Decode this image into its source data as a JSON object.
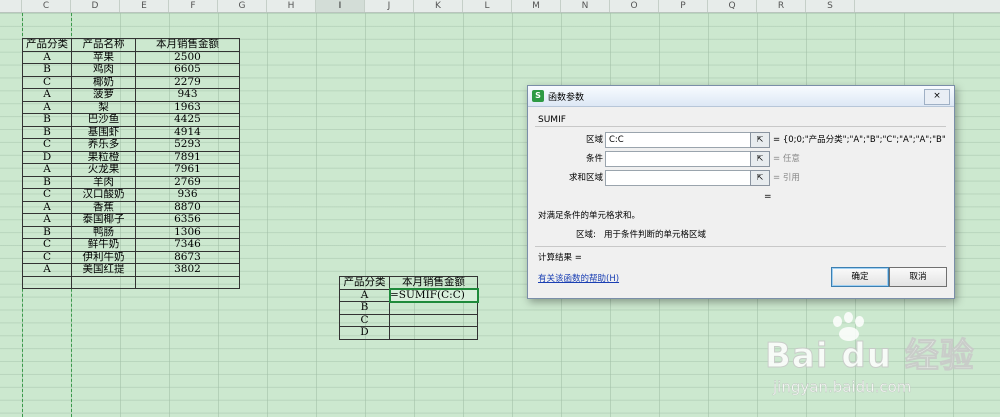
{
  "columns": [
    "C",
    "D",
    "E",
    "F",
    "G",
    "H",
    "I",
    "J",
    "K",
    "L",
    "M",
    "N",
    "O",
    "P",
    "Q",
    "R",
    "S"
  ],
  "selected_column": "I",
  "table1": {
    "headers": [
      "产品分类",
      "产品名称",
      "本月销售金额"
    ],
    "rows": [
      [
        "A",
        "苹果",
        "2500"
      ],
      [
        "B",
        "鸡肉",
        "6605"
      ],
      [
        "C",
        "椰奶",
        "2279"
      ],
      [
        "A",
        "菠萝",
        "943"
      ],
      [
        "A",
        "梨",
        "1963"
      ],
      [
        "B",
        "巴沙鱼",
        "4425"
      ],
      [
        "B",
        "基围虾",
        "4914"
      ],
      [
        "C",
        "养乐多",
        "5293"
      ],
      [
        "D",
        "果粒橙",
        "7891"
      ],
      [
        "A",
        "火龙果",
        "7961"
      ],
      [
        "B",
        "羊肉",
        "2769"
      ],
      [
        "C",
        "汉口酸奶",
        "936"
      ],
      [
        "A",
        "香蕉",
        "8870"
      ],
      [
        "A",
        "泰国椰子",
        "6356"
      ],
      [
        "B",
        "鸭肠",
        "1306"
      ],
      [
        "C",
        "鲜牛奶",
        "7346"
      ],
      [
        "C",
        "伊利牛奶",
        "8673"
      ],
      [
        "A",
        "美国红提",
        "3802"
      ],
      [
        "",
        "",
        ""
      ]
    ]
  },
  "table2": {
    "headers": [
      "产品分类",
      "本月销售金额"
    ],
    "rows": [
      [
        "A",
        "=SUMIF(C:C)"
      ],
      [
        "B",
        ""
      ],
      [
        "C",
        ""
      ],
      [
        "D",
        ""
      ]
    ]
  },
  "dialog": {
    "app_icon": "S",
    "title": "函数参数",
    "close": "×",
    "function_name": "SUMIF",
    "args": [
      {
        "label": "区域",
        "value": "C:C",
        "result": "= {0;0;\"产品分类\";\"A\";\"B\";\"C\";\"A\";\"A\";\"B\";...",
        "dim": false
      },
      {
        "label": "条件",
        "value": "",
        "result": "= 任意",
        "dim": true
      },
      {
        "label": "求和区域",
        "value": "",
        "result": "= 引用",
        "dim": true
      }
    ],
    "pick_icon": "⇱",
    "equals": "=",
    "description": "对满足条件的单元格求和。",
    "arg_desc_label": "区域:",
    "arg_desc": "用于条件判断的单元格区域",
    "calc_result": "计算结果 =",
    "help_link": "有关该函数的帮助(H)",
    "ok": "确定",
    "cancel": "取消"
  },
  "watermark": {
    "logo": "Bai du 经验",
    "url": "jingyan.baidu.com"
  }
}
